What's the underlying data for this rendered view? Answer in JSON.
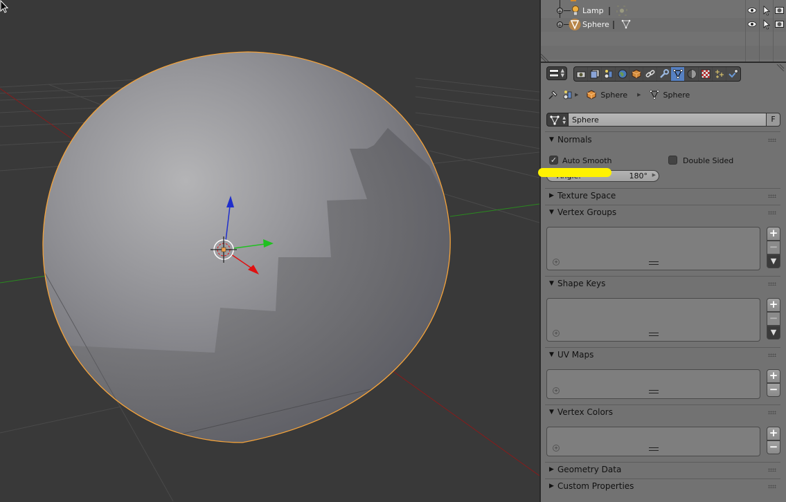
{
  "outliner": {
    "rows": [
      {
        "name": "Lamp",
        "type": "lamp",
        "data_icon": "lamp-data-icon"
      },
      {
        "name": "Sphere",
        "type": "mesh",
        "data_icon": "mesh-data-icon",
        "selected": true
      }
    ],
    "restrict_columns": [
      "visibility",
      "selectability",
      "renderability"
    ]
  },
  "properties": {
    "context_tabs": [
      {
        "name": "render",
        "icon": "camera-icon"
      },
      {
        "name": "render-layers",
        "icon": "render-layers-icon"
      },
      {
        "name": "scene",
        "icon": "scene-icon"
      },
      {
        "name": "world",
        "icon": "world-icon"
      },
      {
        "name": "object",
        "icon": "object-cube-icon"
      },
      {
        "name": "constraints",
        "icon": "constraint-link-icon"
      },
      {
        "name": "modifiers",
        "icon": "wrench-icon"
      },
      {
        "name": "data",
        "icon": "mesh-data-icon",
        "active": true
      },
      {
        "name": "material",
        "icon": "material-sphere-icon"
      },
      {
        "name": "texture",
        "icon": "texture-checker-icon"
      },
      {
        "name": "particles",
        "icon": "particles-icon"
      },
      {
        "name": "physics",
        "icon": "physics-icon"
      }
    ],
    "breadcrumb": {
      "object": "Sphere",
      "mesh": "Sphere"
    },
    "datablock": {
      "name": "Sphere",
      "fake_user_label": "F"
    },
    "panels": {
      "normals": {
        "title": "Normals",
        "expanded": true,
        "auto_smooth_label": "Auto Smooth",
        "auto_smooth_checked": true,
        "double_sided_label": "Double Sided",
        "double_sided_checked": false,
        "angle_label": "Angle:",
        "angle_value": "180°"
      },
      "texture_space": {
        "title": "Texture Space",
        "expanded": false
      },
      "vertex_groups": {
        "title": "Vertex Groups",
        "expanded": true
      },
      "shape_keys": {
        "title": "Shape Keys",
        "expanded": true
      },
      "uv_maps": {
        "title": "UV Maps",
        "expanded": true
      },
      "vertex_colors": {
        "title": "Vertex Colors",
        "expanded": true
      },
      "geometry_data": {
        "title": "Geometry Data",
        "expanded": false
      },
      "custom_properties": {
        "title": "Custom Properties",
        "expanded": false
      }
    },
    "list_buttons": {
      "add": "+",
      "remove": "−",
      "menu": "▼"
    }
  },
  "viewport": {
    "object": "Sphere",
    "selection_outline_color": "#f5a33a",
    "axis_colors": {
      "x": "#8b1a1a",
      "y": "#2a8a1f",
      "z": "#1f2ecc"
    }
  }
}
